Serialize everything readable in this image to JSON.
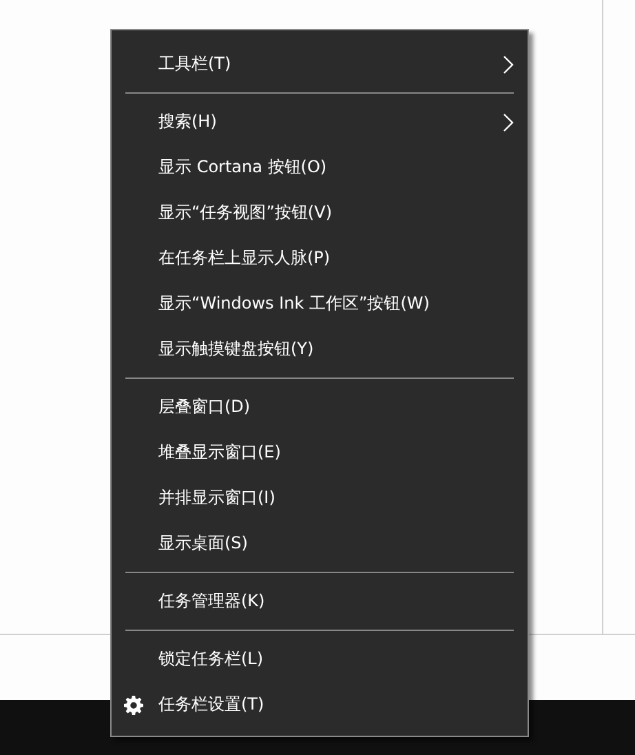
{
  "context_menu": {
    "items": [
      {
        "kind": "item",
        "label": "工具栏(T)",
        "submenu": true,
        "icon": false
      },
      {
        "kind": "separator"
      },
      {
        "kind": "item",
        "label": "搜索(H)",
        "submenu": true,
        "icon": false
      },
      {
        "kind": "item",
        "label": "显示 Cortana 按钮(O)",
        "submenu": false,
        "icon": false
      },
      {
        "kind": "item",
        "label": "显示“任务视图”按钮(V)",
        "submenu": false,
        "icon": false
      },
      {
        "kind": "item",
        "label": "在任务栏上显示人脉(P)",
        "submenu": false,
        "icon": false
      },
      {
        "kind": "item",
        "label": "显示“Windows Ink 工作区”按钮(W)",
        "submenu": false,
        "icon": false
      },
      {
        "kind": "item",
        "label": "显示触摸键盘按钮(Y)",
        "submenu": false,
        "icon": false
      },
      {
        "kind": "separator"
      },
      {
        "kind": "item",
        "label": "层叠窗口(D)",
        "submenu": false,
        "icon": false
      },
      {
        "kind": "item",
        "label": "堆叠显示窗口(E)",
        "submenu": false,
        "icon": false
      },
      {
        "kind": "item",
        "label": "并排显示窗口(I)",
        "submenu": false,
        "icon": false
      },
      {
        "kind": "item",
        "label": "显示桌面(S)",
        "submenu": false,
        "icon": false
      },
      {
        "kind": "separator"
      },
      {
        "kind": "item",
        "label": "任务管理器(K)",
        "submenu": false,
        "icon": false
      },
      {
        "kind": "separator"
      },
      {
        "kind": "item",
        "label": "锁定任务栏(L)",
        "submenu": false,
        "icon": false
      },
      {
        "kind": "item",
        "label": "任务栏设置(T)",
        "submenu": false,
        "icon": true
      }
    ]
  }
}
